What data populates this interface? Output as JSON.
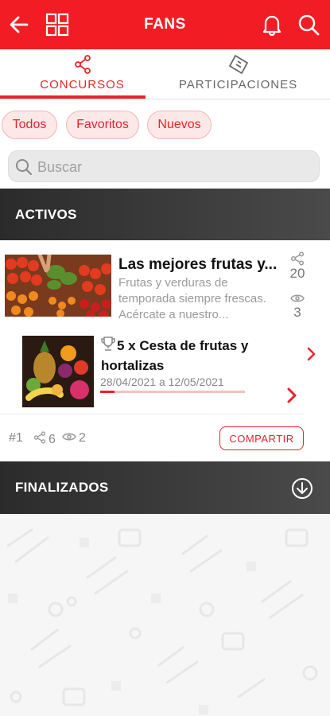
{
  "header": {
    "title": "FANS",
    "back_icon": "arrow-left-icon",
    "grid_icon": "grid-icon",
    "bell_icon": "bell-icon",
    "search_icon": "search-icon",
    "bg_color": "#f21d24"
  },
  "tabs": [
    {
      "label": "CONCURSOS",
      "icon": "share-icon",
      "active": true
    },
    {
      "label": "PARTICIPACIONES",
      "icon": "ticket-icon",
      "active": false
    }
  ],
  "filters": [
    {
      "label": "Todos"
    },
    {
      "label": "Favoritos"
    },
    {
      "label": "Nuevos"
    }
  ],
  "search": {
    "placeholder": "Buscar",
    "value": ""
  },
  "sections": {
    "active_title": "ACTIVOS",
    "finished_title": "FINALIZADOS"
  },
  "contest": {
    "title": "Las mejores frutas y...",
    "description": "Frutas y verduras de temporada siempre frescas. Acércate a nuestro...",
    "shares": "20",
    "views": "3",
    "prize": {
      "title": "5 x Cesta de frutas y hortalizas",
      "dates": "28/04/2021 a 12/05/2021",
      "progress_fraction": 0.1
    },
    "footer": {
      "rank": "#1",
      "share_count": "6",
      "view_count": "2",
      "share_button": "COMPARTIR"
    }
  },
  "colors": {
    "accent": "#e8232a",
    "section_bg": "#333333"
  }
}
